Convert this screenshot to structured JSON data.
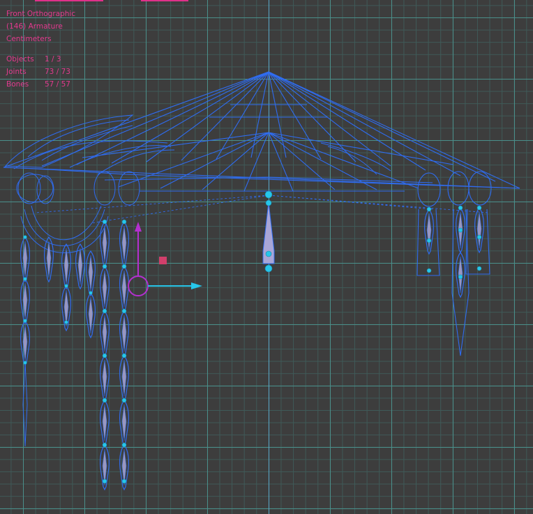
{
  "viewport": {
    "view_name": "Front Orthographic",
    "selection_info": "(146) Armature",
    "units": "Centimeters",
    "stats": [
      {
        "label": "Objects",
        "value": "1 / 3"
      },
      {
        "label": "Joints",
        "value": "73 / 73"
      },
      {
        "label": "Bones",
        "value": "57 / 57"
      }
    ]
  },
  "colors": {
    "background": "#3d3d3d",
    "grid_major": "#4a8f8a",
    "grid_minor": "#3f5a58",
    "wireframe": "#2f6cf0",
    "joint": "#26c6ea",
    "bone_fill": "#a9a6d6",
    "overlay_text": "#e23a8e",
    "gizmo_y": "#b42fd0",
    "gizmo_x": "#26c6ea",
    "gizmo_center": "#d13f6b"
  },
  "icons": {
    "gizmo": "move-gizmo-icon"
  }
}
